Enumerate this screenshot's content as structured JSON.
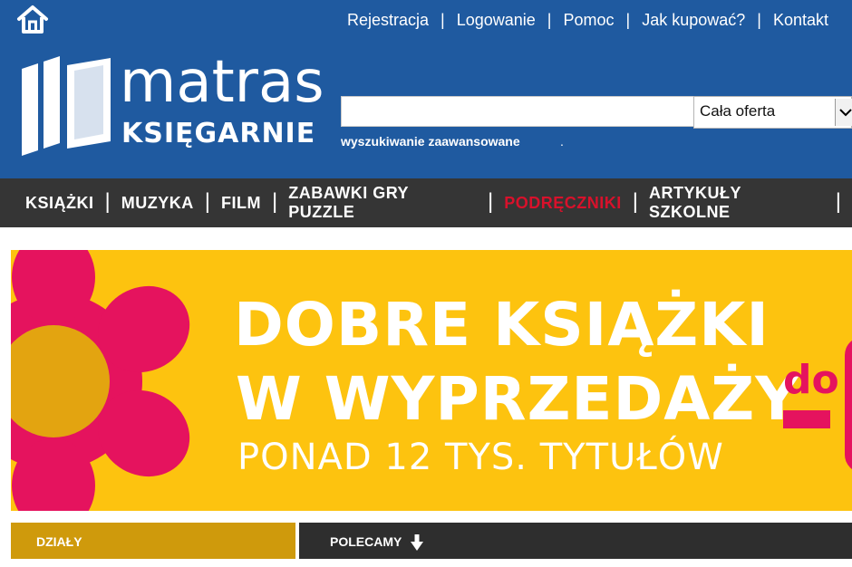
{
  "header": {
    "home_icon": "home-icon",
    "top_links": [
      "Rejestracja",
      "Logowanie",
      "Pomoc",
      "Jak kupować?",
      "Kontakt"
    ],
    "separator": "|",
    "logo": {
      "word": "matras",
      "sub": "KSIĘGARNIE"
    },
    "search": {
      "value": "",
      "category_selected": "Cała oferta",
      "advanced_link": "wyszukiwanie zaawansowane",
      "dot": "."
    }
  },
  "nav": {
    "items": [
      "KSIĄŻKI",
      "MUZYKA",
      "FILM",
      "ZABAWKI GRY PUZZLE",
      "PODRĘCZNIKI",
      "ARTYKUŁY SZKOLNE"
    ],
    "active_index": 4,
    "separator": "|"
  },
  "banner": {
    "line1": "DOBRE KSIĄŻKI",
    "line2": "W WYPRZEDAŻY",
    "line3": "PONAD 12 TYS. TYTUŁÓW",
    "side_text": "do"
  },
  "sections": {
    "dzialy": "DZIAŁY",
    "polecamy": "POLECAMY",
    "polecamy_icon": "arrow-down-icon"
  },
  "colors": {
    "header_bg": "#1f5aa0",
    "nav_bg": "#353535",
    "nav_active": "#d8112b",
    "banner_bg": "#fdc30f",
    "banner_accent": "#e5135e",
    "dzialy_bg": "#cf9a0c",
    "polecamy_bg": "#2e2e2e"
  }
}
